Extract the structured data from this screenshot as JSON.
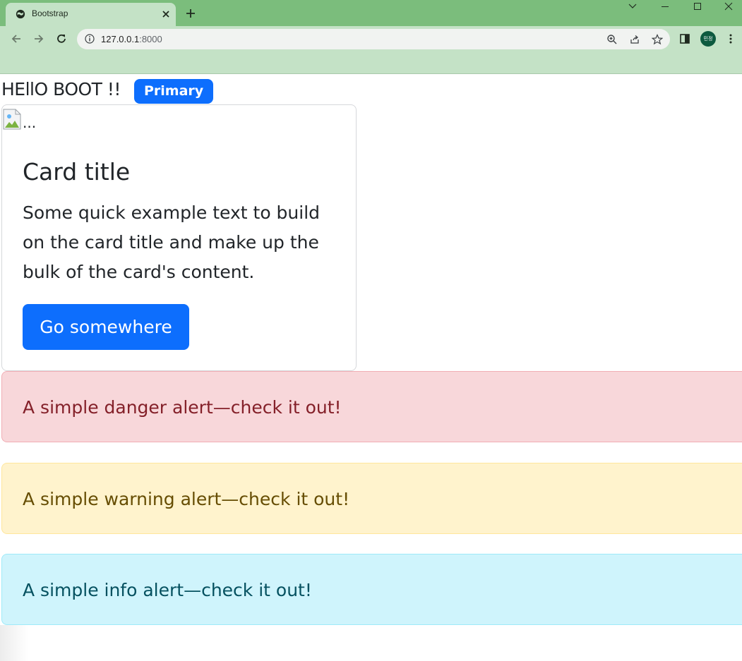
{
  "browser": {
    "tab_title": "Bootstrap",
    "url_host": "127.0.0.1",
    "url_port": ":8000",
    "profile_initials": "민정",
    "colors": {
      "frame": "#7bbd7c",
      "toolbar": "#c4e2c6",
      "omnibox": "#f1f3f1"
    }
  },
  "page": {
    "heading": "HEllO BOOT !!",
    "badge": "Primary",
    "card": {
      "img_alt": "...",
      "title": "Card title",
      "text": "Some quick example text to build on the card title and make up the bulk of the card's content.",
      "button": "Go somewhere"
    },
    "alerts": {
      "danger": "A simple danger alert—check it out!",
      "warning": "A simple warning alert—check it out!",
      "info": "A simple info alert—check it out!"
    },
    "colors": {
      "primary": "#0d6efd",
      "danger_bg": "#f8d7da",
      "warning_bg": "#fff3cd",
      "info_bg": "#cff4fc"
    }
  }
}
